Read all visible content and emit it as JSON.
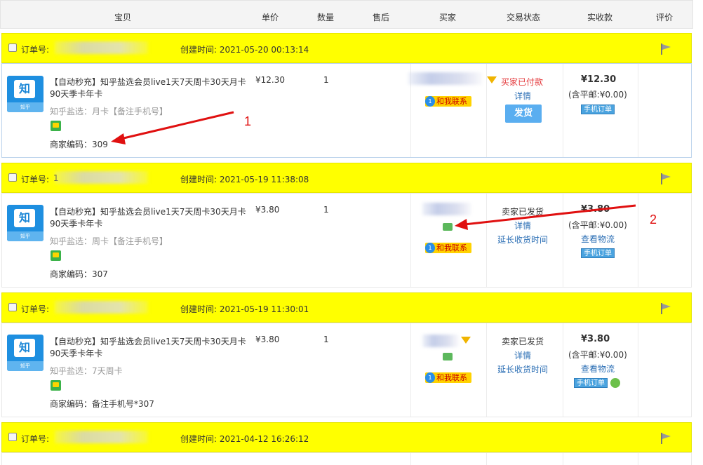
{
  "header": {
    "columns": [
      "宝贝",
      "单价",
      "数量",
      "售后",
      "买家",
      "交易状态",
      "实收款",
      "评价"
    ]
  },
  "orders": [
    {
      "order_label": "订单号:",
      "created": "创建时间: 2021-05-20 00:13:14",
      "thumb_brand": "知",
      "thumb_caption": "知乎",
      "title": "【自动秒充】知乎盐选会员live1天7天周卡30天月卡90天季卡年卡",
      "sku": "知乎盐选：月卡【备注手机号】",
      "merchant_code": "商家编码：309",
      "price": "¥12.30",
      "qty": "1",
      "contact": "和我联系",
      "status": "买家已付款",
      "detail": "详情",
      "ship_button": "发货",
      "amount": "¥12.30",
      "postage": "(含平邮:¥0.00)",
      "mobile_tag": "手机订单"
    },
    {
      "order_label": "订单号:",
      "order_prefix": "1",
      "created": "创建时间: 2021-05-19 11:38:08",
      "thumb_brand": "知",
      "thumb_caption": "知乎",
      "title": "【自动秒充】知乎盐选会员live1天7天周卡30天月卡90天季卡年卡",
      "sku": "知乎盐选：周卡【备注手机号】",
      "merchant_code": "商家编码：307",
      "price": "¥3.80",
      "qty": "1",
      "contact": "和我联系",
      "status": "卖家已发货",
      "detail": "详情",
      "extend": "延长收货时间",
      "amount": "¥3.80",
      "postage": "(含平邮:¥0.00)",
      "logistics": "查看物流",
      "mobile_tag": "手机订单"
    },
    {
      "order_label": "订单号:",
      "created": "创建时间: 2021-05-19 11:30:01",
      "thumb_brand": "知",
      "thumb_caption": "知乎",
      "title": "【自动秒充】知乎盐选会员live1天7天周卡30天月卡90天季卡年卡",
      "sku": "知乎盐选：7天周卡",
      "merchant_code": "商家编码：备注手机号*307",
      "price": "¥3.80",
      "qty": "1",
      "contact": "和我联系",
      "status": "卖家已发货",
      "detail": "详情",
      "extend": "延长收货时间",
      "amount": "¥3.80",
      "postage": "(含平邮:¥0.00)",
      "logistics": "查看物流",
      "mobile_tag": "手机订单"
    },
    {
      "order_label": "订单号:",
      "created": "创建时间: 2021-04-12 16:26:12"
    }
  ],
  "annotations": [
    "1",
    "2"
  ],
  "colors": {
    "highlight_bar": "#ffff00",
    "annotation": "#e01010",
    "link": "#2c6fb5",
    "ship_button": "#5aaef0"
  }
}
